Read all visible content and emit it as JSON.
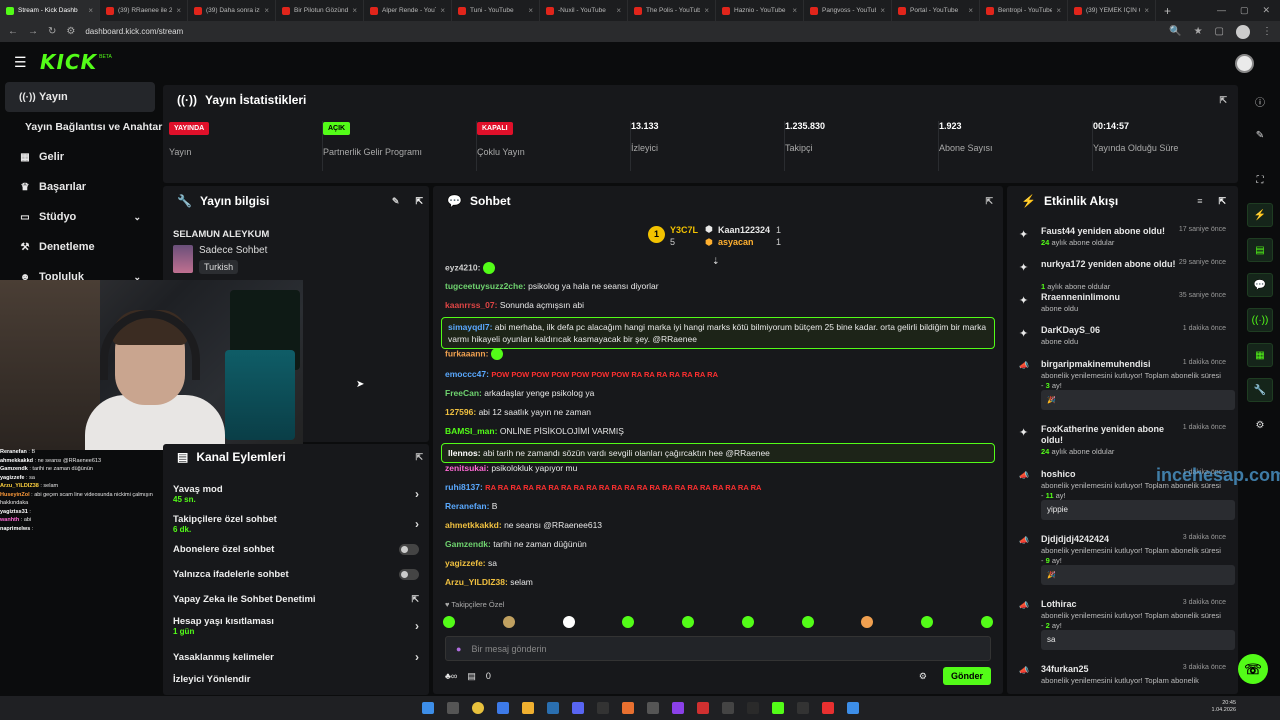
{
  "browser": {
    "tabs": [
      {
        "title": "Stream - Kick Dashb",
        "icon": "kick",
        "active": true
      },
      {
        "title": "(39) RRaenee ile 2 Y",
        "icon": "youtube"
      },
      {
        "title": "(39) Daha sonra izle",
        "icon": "youtube"
      },
      {
        "title": "Bir Pilotun Gözünd",
        "icon": "youtube"
      },
      {
        "title": "Alper Rende - YouT",
        "icon": "youtube"
      },
      {
        "title": "Tuni - YouTube",
        "icon": "youtube"
      },
      {
        "title": "-Nuxil - YouTube",
        "icon": "youtube"
      },
      {
        "title": "The Polis - YouTube",
        "icon": "youtube"
      },
      {
        "title": "Haznio - YouTube",
        "icon": "youtube"
      },
      {
        "title": "Pangvoss - YouTube",
        "icon": "youtube"
      },
      {
        "title": "Portal - YouTube",
        "icon": "youtube"
      },
      {
        "title": "Bentropi - YouTube",
        "icon": "youtube"
      },
      {
        "title": "(39) YEMEK İÇİN GE",
        "icon": "youtube"
      }
    ],
    "url": "dashboard.kick.com/stream"
  },
  "brand": {
    "logo": "KICK",
    "beta": "BETA",
    "accent": "#53fc18"
  },
  "sidebar": {
    "items": [
      {
        "label": "Yayın",
        "icon": "broadcast-icon"
      },
      {
        "label": "Yayın Bağlantısı ve Anahtarı",
        "icon": ""
      },
      {
        "label": "Gelir",
        "icon": "bank-icon"
      },
      {
        "label": "Başarılar",
        "icon": "trophy-icon"
      },
      {
        "label": "Stüdyo",
        "icon": "studio-icon"
      },
      {
        "label": "Denetleme",
        "icon": "hammer-icon"
      },
      {
        "label": "Topluluk",
        "icon": "people-icon"
      }
    ]
  },
  "stats": {
    "title": "Yayın İstatistikleri",
    "items": [
      {
        "badge": "YAYINDA",
        "badge_color": "#e0102a",
        "label": "Yayın"
      },
      {
        "badge": "AÇIK",
        "badge_color": "#53fc18",
        "label": "Partnerlik Gelir Programı"
      },
      {
        "badge": "KAPALI",
        "badge_color": "#e0102a",
        "label": "Çoklu Yayın"
      },
      {
        "value": "13.133",
        "label": "İzleyici"
      },
      {
        "value": "1.235.830",
        "label": "Takipçi"
      },
      {
        "value": "1.923",
        "label": "Abone Sayısı"
      },
      {
        "value": "00:14:57",
        "label": "Yayında Olduğu Süre"
      }
    ]
  },
  "stream_info": {
    "title": "Yayın bilgisi",
    "stream_title": "SELAMUN ALEYKUM",
    "category": "Sadece Sohbet",
    "tag": "Turkish"
  },
  "overlay_chat": [
    {
      "user": "Reranefan",
      "text": "B",
      "color": "#ffffff"
    },
    {
      "user": "ahmekkakkd",
      "text": "ne seansı @RRaenee613",
      "color": "#ffffff"
    },
    {
      "user": "Gamzendk",
      "text": "tarihi ne zaman düğünün",
      "color": "#ffffff"
    },
    {
      "user": "yagizzefe",
      "text": "sa",
      "color": "#ffffff"
    },
    {
      "user": "Arzu_YILDIZ38",
      "text": "selam",
      "color": "#ffd23f"
    },
    {
      "user": "HuseyinZol",
      "text": "abi geçen scam line videosunda nickimi çalmışın hakkındaka",
      "color": "#ff9b3a"
    },
    {
      "user": "yagiztss31",
      "text": "",
      "color": "#ffffff"
    },
    {
      "user": "wanhth",
      "text": "abi",
      "color": "#ff6ad5"
    },
    {
      "user": "naprimelws",
      "text": "",
      "color": "#ffffff"
    }
  ],
  "channel_actions": {
    "title": "Kanal Eylemleri",
    "items": [
      {
        "label": "Yavaş mod",
        "sub": "45 sn.",
        "control": "chevron"
      },
      {
        "label": "Takipçilere özel sohbet",
        "sub": "6 dk.",
        "control": "chevron"
      },
      {
        "label": "Abonelere özel sohbet",
        "sub": "",
        "control": "toggle"
      },
      {
        "label": "Yalnızca ifadelerle sohbet",
        "sub": "",
        "control": "toggle"
      },
      {
        "label": "Yapay Zeka ile Sohbet Denetimi",
        "sub": "",
        "control": "external"
      },
      {
        "label": "Hesap yaşı kısıtlaması",
        "sub": "1 gün",
        "control": "chevron"
      },
      {
        "label": "Yasaklanmış kelimeler",
        "sub": "",
        "control": "chevron"
      },
      {
        "label": "İzleyici Yönlendir",
        "sub": "",
        "control": ""
      }
    ]
  },
  "chat": {
    "title": "Sohbet",
    "leader_rank": "1",
    "leaders": [
      {
        "name": "Y3C7L",
        "count": "5",
        "color": "#f2c200"
      },
      {
        "name": "Kaan122324",
        "count": "1",
        "color": "#ffffff"
      },
      {
        "name": "asyacan",
        "count": "1",
        "color": "#ffb030"
      }
    ],
    "messages": [
      {
        "user": "eyz4210:",
        "text": "",
        "color": "#d0d0d0",
        "emote": true
      },
      {
        "user": "tugceetuysuzz2che:",
        "text": "psikolog ya hala ne seansı diyorlar",
        "color": "#6fd36f"
      },
      {
        "user": "kaanrrss_07:",
        "text": "Sonunda açmışsın abi",
        "color": "#e04545"
      },
      {
        "user": "simayqdl7:",
        "text": "abi merhaba, ilk defa pc alacağım hangi marka iyi hangi marks kötü bilmiyorum bütçem 25 bine kadar. orta gelirli bildiğim bir marka varmı hikayeli oyunları kaldırıcak kasmayacak bir şey. @RRaenee",
        "color": "#5aa9ff",
        "highlight": true
      },
      {
        "user": "furkaaann:",
        "text": "",
        "color": "#f0a050",
        "emote": true
      },
      {
        "user": "emoccc47:",
        "text": "POW POW POW POW POW POW POW RA RA RA RA RA RA RA",
        "color": "#5aa9ff",
        "red": true
      },
      {
        "user": "FreeCan:",
        "text": "arkadaşlar yenge psikolog ya",
        "color": "#6fd36f"
      },
      {
        "user": "127596:",
        "text": "abi 12 saatlık yayın ne zaman",
        "color": "#f0c040"
      },
      {
        "user": "BAMSI_man:",
        "text": "ONLİNE PİSİKOLOJİMİ VARMIŞ",
        "color": "#53fc18"
      },
      {
        "user": "llennos:",
        "text": "abi tarih ne zamandı sözün vardı sevgili olanları çağırcaktın hee @RRaenee",
        "color": "#ffffff",
        "highlight": true
      },
      {
        "user": "zenitsukai:",
        "text": "psikolokluk yapıyor mu",
        "color": "#ff6ad5"
      },
      {
        "user": "ruhi8137:",
        "text": "RA RA RA RA RA RA RA RA RA RA RA RA RA RA RA RA RA RA RA RA RA RA",
        "color": "#5aa9ff",
        "red": true
      },
      {
        "user": "Reranefan:",
        "text": "B",
        "color": "#5aa9ff"
      },
      {
        "user": "ahmetkkakkd:",
        "text": "ne seansı @RRaenee613",
        "color": "#f0c040"
      },
      {
        "user": "Gamzendk:",
        "text": "tarihi ne zaman düğünün",
        "color": "#6fd36f"
      },
      {
        "user": "yagizzefe:",
        "text": "sa",
        "color": "#f0c040"
      },
      {
        "user": "Arzu_YILDIZ38:",
        "text": "selam",
        "color": "#f0c040"
      }
    ],
    "followers_only": "Takipçilere Özel",
    "input_placeholder": "Bir mesaj gönderin",
    "send": "Gönder",
    "bottom_count": "0"
  },
  "activity": {
    "title": "Etkinlik Akışı",
    "events": [
      {
        "name": "Faust44 yeniden abone oldu!",
        "time": "17 saniye önce",
        "detail_num": "24",
        "detail": "aylık abone oldular",
        "icon": "star"
      },
      {
        "name": "nurkya172 yeniden abone oldu!",
        "time": "29 saniye önce",
        "detail_num": "1",
        "detail": "aylık abone oldular",
        "icon": "star"
      },
      {
        "name": "Rraenneninlimonu",
        "time": "35 saniye önce",
        "detail_num": "",
        "detail": "abone oldu",
        "icon": "star"
      },
      {
        "name": "DarKDayS_06",
        "time": "1 dakika önce",
        "detail_num": "",
        "detail": "abone oldu",
        "icon": "star"
      },
      {
        "name": "birgaripmakinemuhendisi",
        "time": "1 dakika önce",
        "detail": "abonelik yenilemesini kutluyor! Toplam abonelik süresi -",
        "detail_num": "3",
        "detail_end": "ay!",
        "box": "",
        "icon": "megaphone"
      },
      {
        "name": "FoxKatherine yeniden abone oldu!",
        "time": "1 dakika önce",
        "detail_num": "24",
        "detail": "aylık abone oldular",
        "icon": "star"
      },
      {
        "name": "hoshico",
        "time": "1 dakika önce",
        "detail": "abonelik yenilemesini kutluyor! Toplam abonelik süresi -",
        "detail_num": "11",
        "detail_end": "ay!",
        "box": "yippie",
        "icon": "megaphone"
      },
      {
        "name": "Djdjdjdj4242424",
        "time": "3 dakika önce",
        "detail": "abonelik yenilemesini kutluyor! Toplam abonelik süresi -",
        "detail_num": "9",
        "detail_end": "ay!",
        "box": "",
        "icon": "megaphone"
      },
      {
        "name": "Lothirac",
        "time": "3 dakika önce",
        "detail": "abonelik yenilemesini kutluyor! Toplam abonelik süresi -",
        "detail_num": "2",
        "detail_end": "ay!",
        "box": "sa",
        "icon": "megaphone"
      },
      {
        "name": "34furkan25",
        "time": "3 dakika önce",
        "detail": "abonelik yenilemesini kutluyor! Toplam abonelik",
        "detail_num": "",
        "detail_end": "",
        "icon": "megaphone"
      }
    ]
  },
  "watermark": "incehesap.com",
  "clock": {
    "time": "20:45",
    "date": "1.04.2026"
  }
}
